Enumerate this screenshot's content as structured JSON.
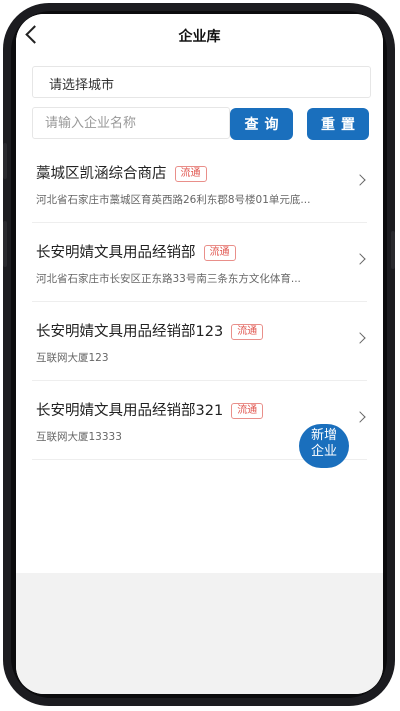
{
  "header": {
    "title": "企业库"
  },
  "filters": {
    "city_value": "请选择城市",
    "search_placeholder": "请输入企业名称",
    "query_label": "查询",
    "reset_label": "重置"
  },
  "companies": [
    {
      "name": "藁城区凯涵综合商店",
      "badge": "流通",
      "address": "河北省石家庄市藁城区育英西路26利东郡8号楼01单元底..."
    },
    {
      "name": "长安明婧文具用品经销部",
      "badge": "流通",
      "address": "河北省石家庄市长安区正东路33号南三条东方文化体育..."
    },
    {
      "name": "长安明婧文具用品经销部123",
      "badge": "流通",
      "address": "互联网大厦123"
    },
    {
      "name": "长安明婧文具用品经销部321",
      "badge": "流通",
      "address": "互联网大厦13333"
    }
  ],
  "fab": {
    "label": "新增企业"
  },
  "colors": {
    "primary": "#1a6fbd",
    "badge": "#e0554e"
  }
}
